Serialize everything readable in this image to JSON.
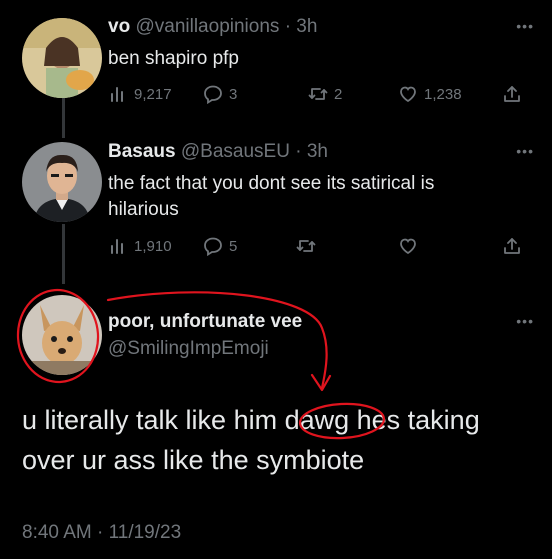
{
  "tweet1": {
    "name": "vo",
    "handle": "@vanillaopinions",
    "time": "3h",
    "text": "ben shapiro pfp",
    "stats": {
      "views": "9,217",
      "replies": "3",
      "retweets": "2",
      "likes": "1,238"
    }
  },
  "tweet2": {
    "name": "Basaus",
    "handle": "@BasausEU",
    "time": "3h",
    "text": "the fact that you dont see its satirical is hilarious",
    "stats": {
      "views": "1,910",
      "replies": "5",
      "retweets": "",
      "likes": ""
    }
  },
  "tweet3": {
    "name": "poor, unfortunate vee",
    "handle": "@SmilingImpEmoji",
    "text": "u literally talk like him dawg hes taking over ur ass like the symbiote",
    "timestamp": "8:40 AM · 11/19/23"
  },
  "colors": {
    "annotation": "#e0141e",
    "muted": "#71767b",
    "text": "#e7e9ea"
  },
  "icons": [
    "analytics-icon",
    "reply-icon",
    "retweet-icon",
    "like-icon",
    "share-icon",
    "more-icon"
  ]
}
